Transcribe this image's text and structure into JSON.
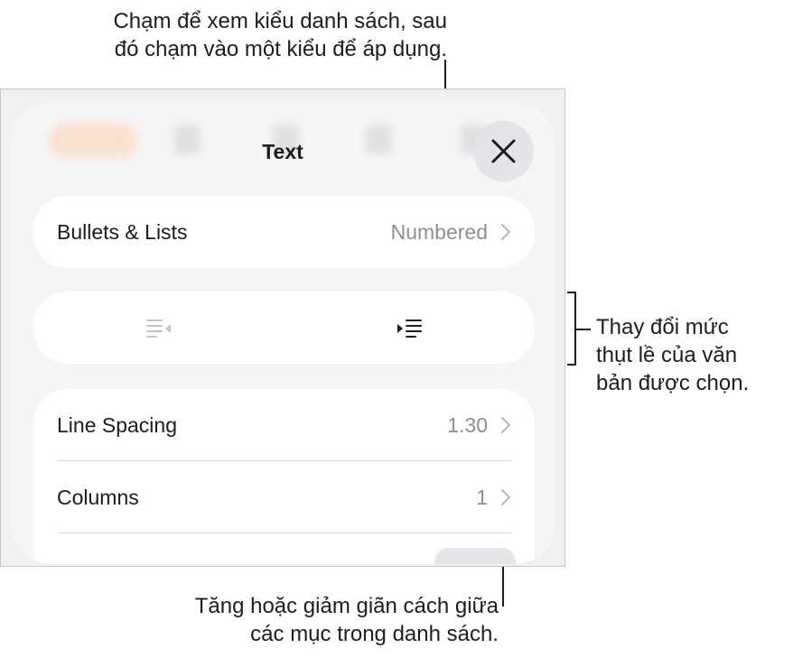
{
  "callouts": {
    "top": [
      "Chạm để xem kiểu danh sách, sau",
      "đó chạm vào một kiểu để áp dụng."
    ],
    "right": [
      "Thay đổi mức",
      "thụt lề của văn",
      "bản được chọn."
    ],
    "bottom": [
      "Tăng hoặc giảm giãn cách giữa",
      "các mục trong danh sách."
    ]
  },
  "sheet": {
    "title": "Text",
    "close_icon": "xmark-icon",
    "bullets_lists": {
      "label": "Bullets & Lists",
      "value": "Numbered"
    },
    "indent": {
      "decrease_icon": "decrease-indent-icon",
      "increase_icon": "increase-indent-icon"
    },
    "line_spacing": {
      "label": "Line Spacing",
      "value": "1.30"
    },
    "columns": {
      "label": "Columns",
      "value": "1"
    }
  },
  "colors": {
    "accent_blurred": "#ffcfb0",
    "panel_bg": "#f5f5f7",
    "card_bg": "#ffffff",
    "secondary_text": "#8e8e93"
  }
}
